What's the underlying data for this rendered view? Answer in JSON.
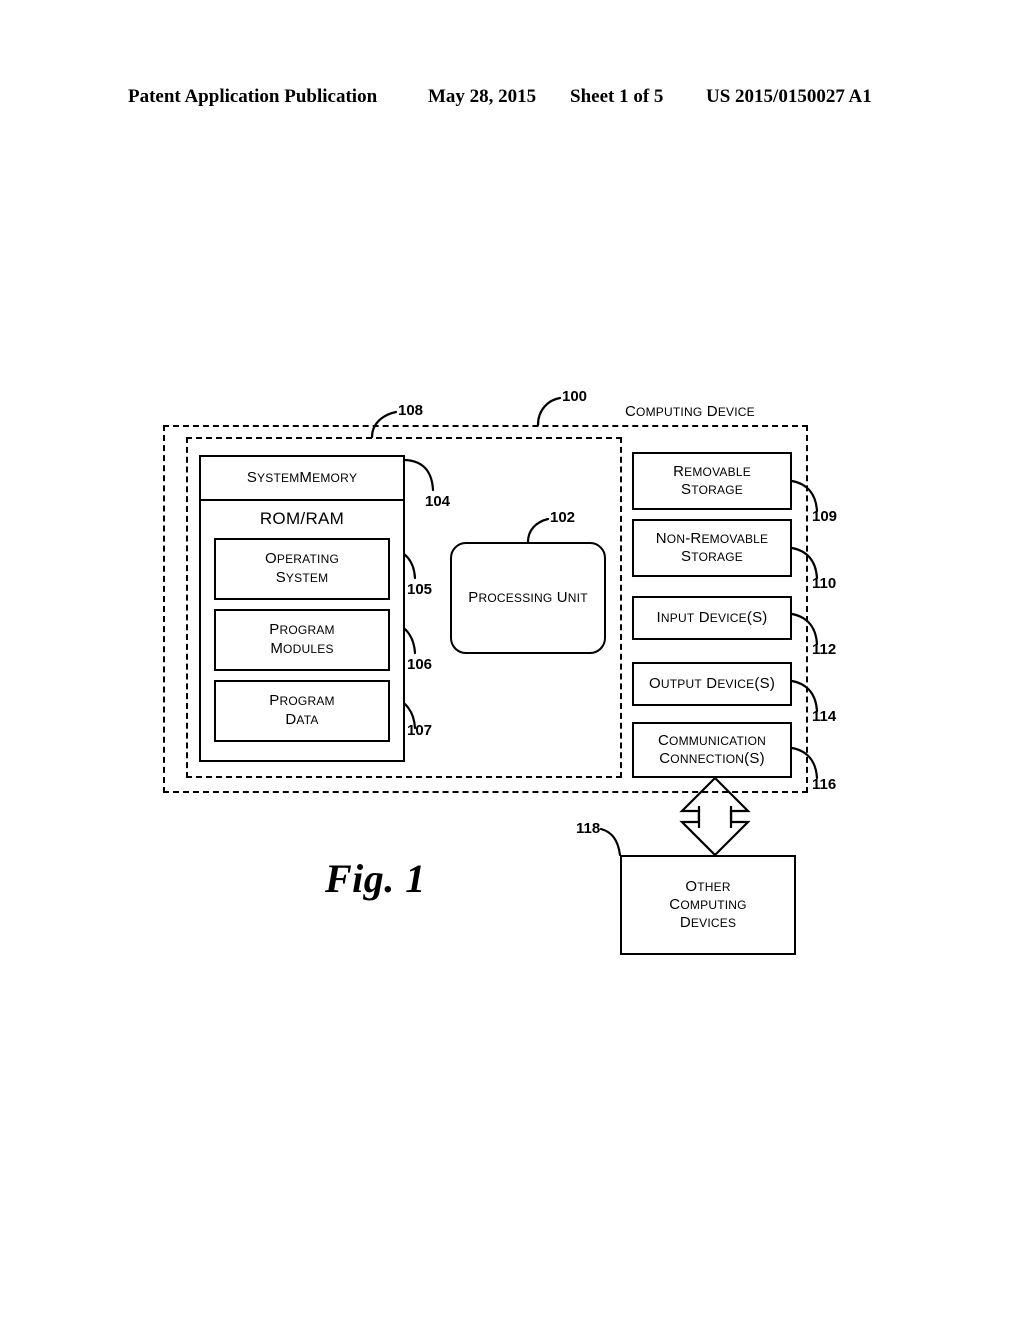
{
  "header": {
    "publication": "Patent Application Publication",
    "date": "May 28, 2015",
    "sheet": "Sheet 1 of 5",
    "publication_number": "US 2015/0150027 A1"
  },
  "figure": {
    "caption": "Fig. 1",
    "device_label": "COMPUTING DEVICE",
    "boundaries": [
      {
        "ref": "100",
        "name": "computing-device-boundary"
      },
      {
        "ref": "108",
        "name": "basic-configuration-boundary"
      }
    ],
    "memory": {
      "title": "SYSTEM MEMORY",
      "title_ref": "104",
      "rom_ram": "ROM/RAM",
      "items": [
        {
          "lines": [
            "OPERATING",
            "SYSTEM"
          ],
          "ref": "105"
        },
        {
          "lines": [
            "PROGRAM",
            "MODULES"
          ],
          "ref": "106"
        },
        {
          "lines": [
            "PROGRAM",
            "DATA"
          ],
          "ref": "107"
        }
      ]
    },
    "processing_unit": {
      "label": "PROCESSING UNIT",
      "ref": "102"
    },
    "peripherals": [
      {
        "lines": [
          "REMOVABLE",
          "STORAGE"
        ],
        "ref": "109",
        "name": "removable-storage"
      },
      {
        "lines": [
          "NON-REMOVABLE",
          "STORAGE"
        ],
        "ref": "110",
        "name": "non-removable-storage"
      },
      {
        "lines": [
          "INPUT DEVICE(S)"
        ],
        "ref": "112",
        "name": "input-devices"
      },
      {
        "lines": [
          "OUTPUT DEVICE(S)"
        ],
        "ref": "114",
        "name": "output-devices"
      },
      {
        "lines": [
          "COMMUNICATION",
          "CONNECTION(S)"
        ],
        "ref": "116",
        "name": "communication-connections"
      }
    ],
    "other_devices": {
      "lines": [
        "OTHER",
        "COMPUTING",
        "DEVICES"
      ],
      "ref": "118",
      "name": "other-computing-devices"
    }
  }
}
